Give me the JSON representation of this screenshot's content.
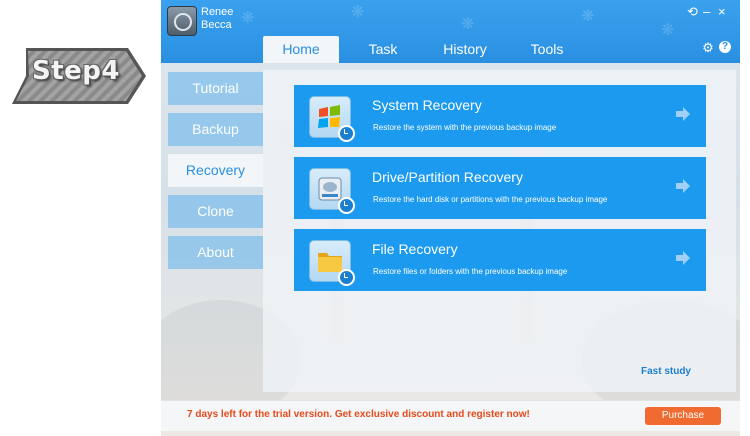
{
  "step_badge": {
    "label": "Step4"
  },
  "app": {
    "name_line1": "Renee",
    "name_line2": "Becca"
  },
  "window_controls": {
    "settings": "⚙",
    "help": "?",
    "minimize": "–",
    "close": "×",
    "restore": "⟲"
  },
  "tabs": [
    {
      "label": "Home",
      "active": true
    },
    {
      "label": "Task",
      "active": false
    },
    {
      "label": "History",
      "active": false
    },
    {
      "label": "Tools",
      "active": false
    }
  ],
  "sidebar": {
    "items": [
      {
        "label": "Tutorial",
        "active": false
      },
      {
        "label": "Backup",
        "active": false
      },
      {
        "label": "Recovery",
        "active": true
      },
      {
        "label": "Clone",
        "active": false
      },
      {
        "label": "About",
        "active": false
      }
    ]
  },
  "cards": [
    {
      "title": "System Recovery",
      "desc": "Restore the system with the previous backup image",
      "icon": "windows-restore-icon"
    },
    {
      "title": "Drive/Partition Recovery",
      "desc": "Restore the hard disk or partitions with the previous backup image",
      "icon": "disk-restore-icon"
    },
    {
      "title": "File Recovery",
      "desc": "Restore files or folders with the previous backup image",
      "icon": "folder-restore-icon"
    }
  ],
  "fast_study": "Fast study",
  "trial": {
    "text": "7 days left for the trial version. Get exclusive discount and register now!",
    "button": "Purchase"
  },
  "colors": {
    "title_bar": "#2f95e6",
    "card": "#1b9aef",
    "trial_text": "#e84a1b",
    "purchase_button": "#f06b2f",
    "accent": "#2a8fe0"
  }
}
